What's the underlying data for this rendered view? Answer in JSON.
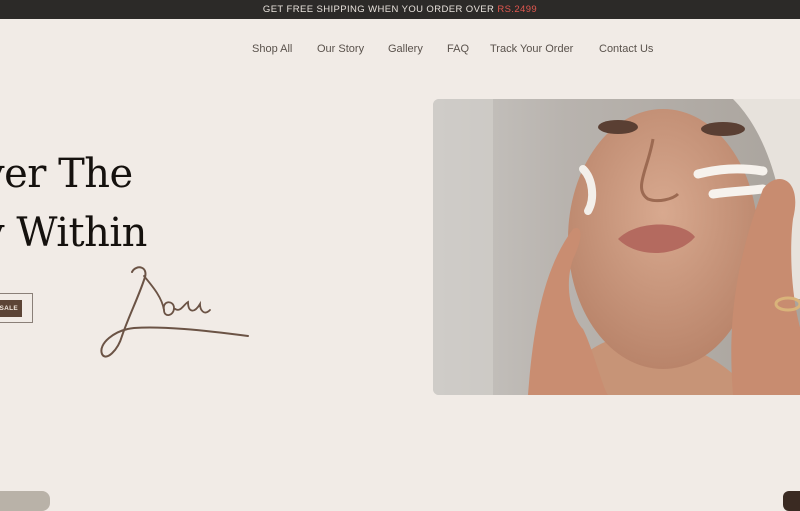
{
  "announcement": {
    "text": "GET FREE SHIPPING WHEN YOU ORDER OVER",
    "price": "RS.2499"
  },
  "nav": {
    "items": [
      "Shop All",
      "Our Story",
      "Gallery",
      "FAQ",
      "Track Your Order",
      "Contact Us"
    ]
  },
  "hero": {
    "title_line1": "ver The",
    "title_line2": "y Within",
    "script_word": "You",
    "button_label": "SALE",
    "image_alt": "Woman applying face cream"
  },
  "colors": {
    "background": "#f1ebe6",
    "announcement_bar": "#2c2a28",
    "price_accent": "#e0574f",
    "button_fill": "#5c4436",
    "script_ink": "#6b5345"
  }
}
